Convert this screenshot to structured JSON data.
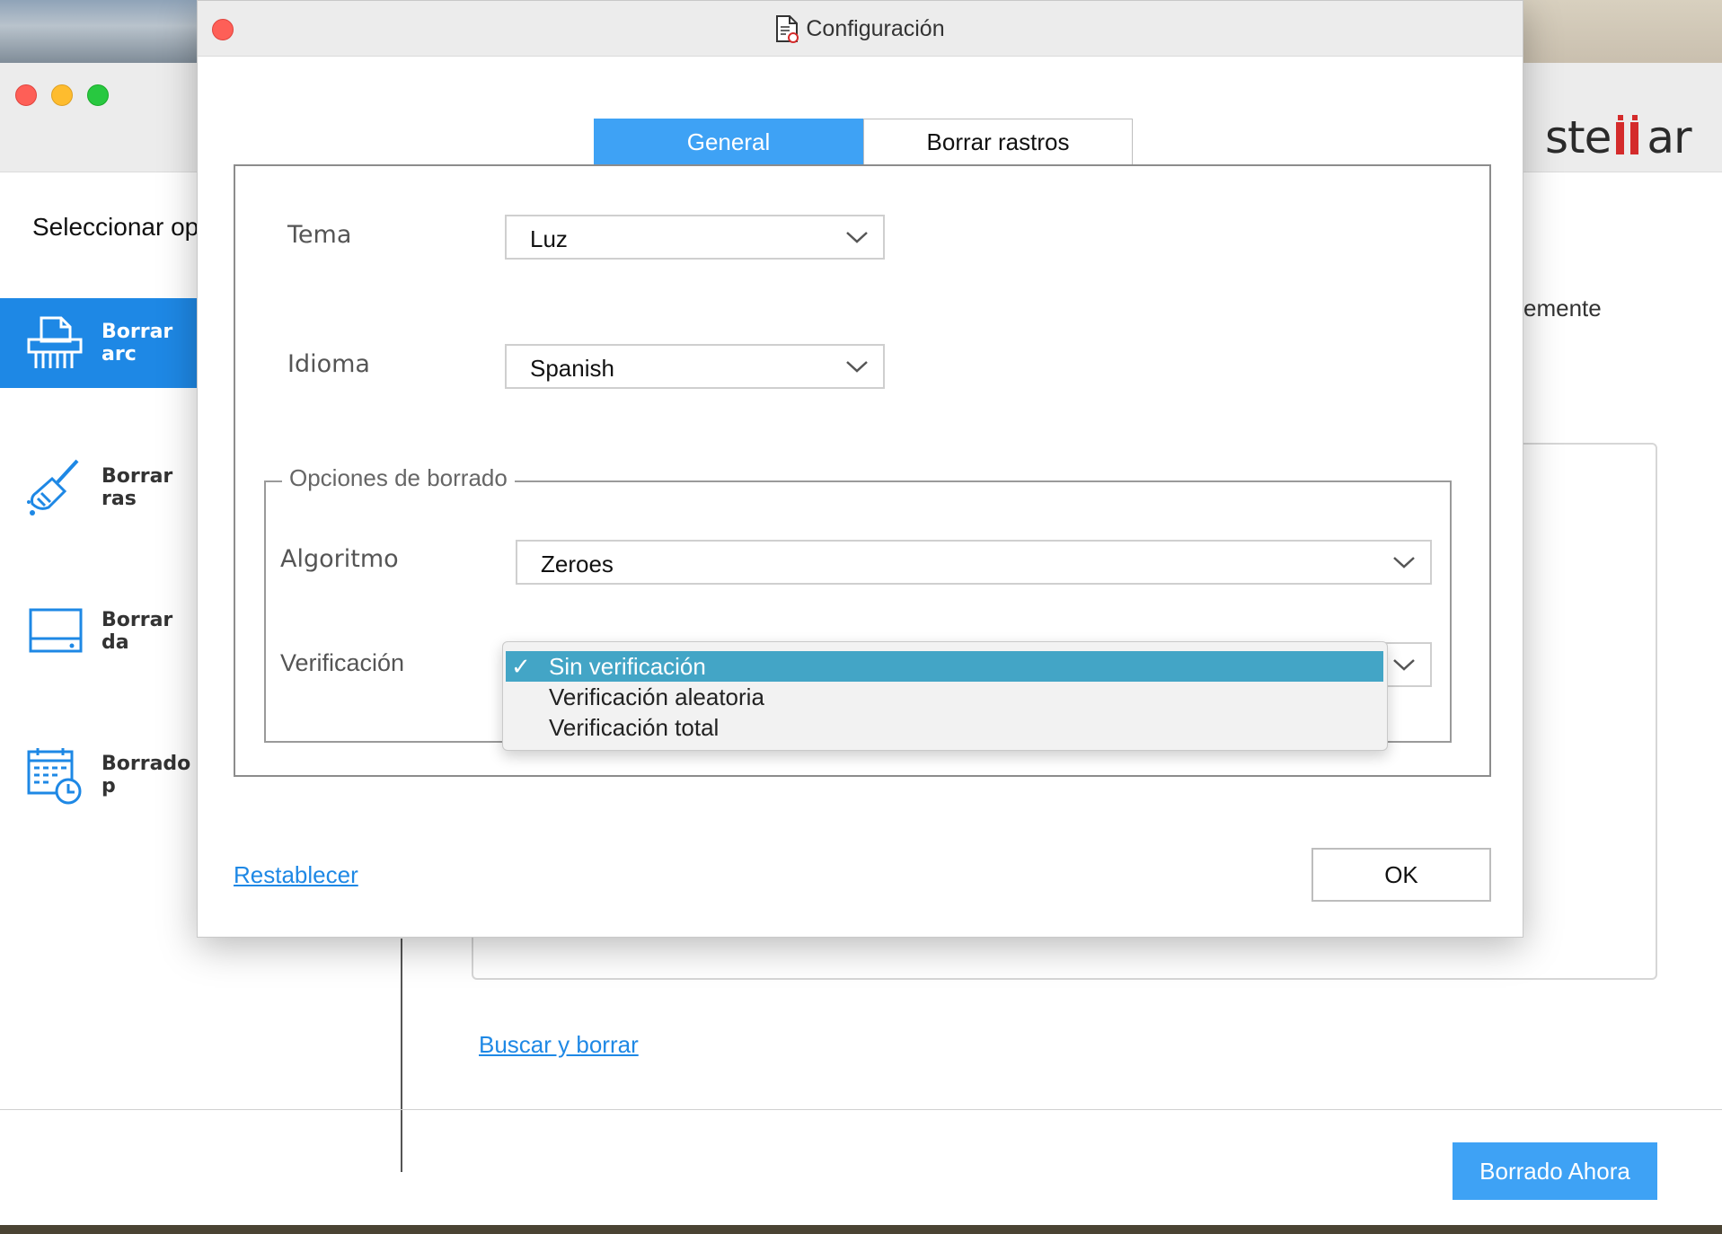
{
  "app": {
    "logo_text": "stellar",
    "select_heading": "Seleccionar op",
    "sidebar": {
      "items": [
        {
          "label": "Borrar arc",
          "icon": "shredder-icon",
          "active": true
        },
        {
          "label": "Borrar ras",
          "icon": "broom-icon",
          "active": false
        },
        {
          "label": "Borrar da",
          "icon": "drive-icon",
          "active": false
        },
        {
          "label": "Borrado p",
          "icon": "calendar-clock-icon",
          "active": false
        }
      ]
    },
    "fragment_text": "emente",
    "search_link": "Buscar y borrar",
    "erase_now_button": "Borrado Ahora"
  },
  "dialog": {
    "title": "Configuración",
    "title_icon": "document-settings-icon",
    "tabs": [
      {
        "label": "General",
        "active": true
      },
      {
        "label": "Borrar rastros",
        "active": false
      }
    ],
    "theme": {
      "label": "Tema",
      "value": "Luz"
    },
    "language": {
      "label": "Idioma",
      "value": "Spanish"
    },
    "erase_options": {
      "legend": "Opciones de borrado",
      "algorithm": {
        "label": "Algoritmo",
        "value": "Zeroes"
      },
      "verification": {
        "label": "Verificación",
        "options": [
          "Sin verificación",
          "Verificación aleatoria",
          "Verificación total"
        ],
        "selected": "Sin verificación",
        "check_mark": "✓"
      }
    },
    "reset_link": "Restablecer",
    "ok_button": "OK"
  },
  "colors": {
    "accent": "#3ea2f5",
    "sidebar_active": "#1e88e5",
    "dropdown_highlight": "#43a5c6",
    "close_red": "#fe5f57"
  }
}
